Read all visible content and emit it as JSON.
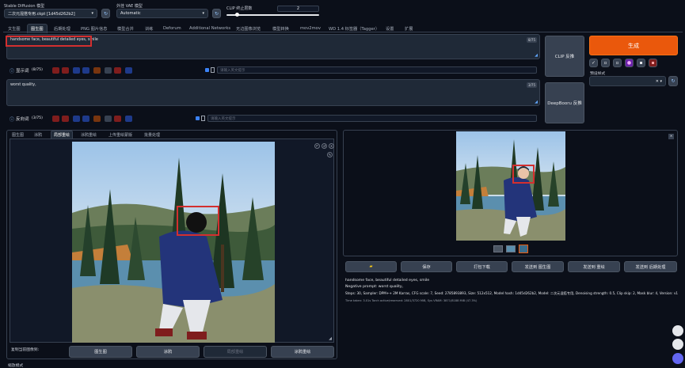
{
  "header": {
    "sd_model_label": "Stable Diffusion 模型",
    "sd_model_value": "二次元混搭专用.ckpt [1d45d262b2]",
    "vae_label": "外挂 VAE 模型",
    "vae_value": "Automatic",
    "clip_label": "CLIP 终止层数",
    "clip_value": "2"
  },
  "tabs": [
    "文生图",
    "图生图",
    "后期处理",
    "PNG 图片信息",
    "模型合并",
    "训练",
    "Deforum",
    "Additional Networks",
    "无边图像浏览",
    "模型转换",
    "mov2mov",
    "WD 1.4 标签器（Tagger）",
    "设置",
    "扩展"
  ],
  "prompt": {
    "text": "handsome face, beautiful detailed eyes, smile",
    "counter": "8/75",
    "label": "显示词",
    "count": "(8/75)",
    "placeholder": "请输入英文提示"
  },
  "negative": {
    "text": "worst quality,",
    "counter": "3/75",
    "label": "反向词",
    "count": "(3/75)",
    "placeholder": "请输入英文提示"
  },
  "right": {
    "clip_btn": "CLIP 反推",
    "deepbooru_btn": "DeepBooru 反推",
    "generate_btn": "生成",
    "styles_label": "预设样式"
  },
  "subtabs": [
    "图生图",
    "涂鸦",
    "局部重绘",
    "涂鸦重绘",
    "上传重绘蒙版",
    "批量处理"
  ],
  "canvas": {
    "copy_label": "复制当前图像到:",
    "buttons": [
      "图生图",
      "涂鸦",
      "局部重绘",
      "涂鸦重绘"
    ]
  },
  "footer": {
    "resize_label": "缩放模式"
  },
  "output": {
    "folder_icon": "folder-icon",
    "buttons": [
      "保存",
      "打包下载",
      "发送到 图生图",
      "发送到 重绘",
      "发送到 后期处理"
    ],
    "info_line1": "handsome face, beautiful detailed eyes, smile",
    "info_line2": "Negative prompt: worst quality,",
    "info_line3": "Steps: 30, Sampler: DPM++ 2M Karras, CFG scale: 7, Seed: 2785893893, Size: 512x512, Model hash: 1d45d262b2, Model: 二次元混搭专用, Denoising strength: 0.5, Clip skip: 2, Mask blur: 4, Version: v1.3.1",
    "info_line4": "Time taken: 3.01s Torch active/reserved: 2801/3720 MiB, Sys VRAM: 3871/8188 MiB (47.3%)"
  },
  "colors": {
    "accent": "#ea580c",
    "highlight": "#d32f2f",
    "background": "#0b0f19"
  }
}
